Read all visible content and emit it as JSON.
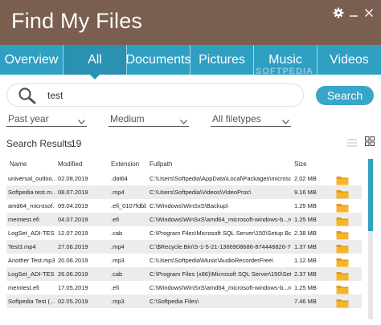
{
  "app": {
    "title": "Find My Files"
  },
  "tabs": [
    {
      "label": "Overview",
      "active": false
    },
    {
      "label": "All",
      "active": true
    },
    {
      "label": "Documents",
      "active": false
    },
    {
      "label": "Pictures",
      "active": false
    },
    {
      "label": "Music",
      "active": false
    },
    {
      "label": "Videos",
      "active": false
    }
  ],
  "watermark": "SOFTPEDIA",
  "search": {
    "value": "test",
    "button_label": "Search"
  },
  "filters": {
    "date": "Past year",
    "size": "Medium",
    "filetype": "All filetypes"
  },
  "results": {
    "label": "Search Results:",
    "count": "19"
  },
  "table": {
    "columns": {
      "name": "Name",
      "modified": "Modified",
      "extension": "Extension",
      "fullpath": "Fullpath",
      "size": "Size"
    },
    "rows": [
      {
        "name": "universal_outloo...",
        "modified": "02.08.2019",
        "ext": ".dat64",
        "path": "C:\\Users\\Softpedia\\AppData\\Local\\Packages\\microsoft.wi...",
        "size": "2.02 MB"
      },
      {
        "name": "Softpedia test.m...",
        "modified": "08.07.2019",
        "ext": ".mp4",
        "path": "C:\\Users\\Softpedia\\Videos\\VideoProc\\",
        "size": "9.16 MB"
      },
      {
        "name": "amd64_microsof...",
        "modified": "09.04.2019",
        "ext": ".efi_0107fdbb",
        "path": "C:\\Windows\\WinSxS\\Backup\\",
        "size": "1.25 MB"
      },
      {
        "name": "memtest.efi",
        "modified": "04.07.2019",
        "ext": ".efi",
        "path": "C:\\Windows\\WinSxS\\amd64_microsoft-windows-b...re-me...",
        "size": "1.25 MB"
      },
      {
        "name": "LogSet_ADI-TES...",
        "modified": "12.07.2019",
        "ext": ".cab",
        "path": "C:\\Program Files\\Microsoft SQL Server\\150\\Setup Bo...",
        "size": "2.38 MB"
      },
      {
        "name": "Test3.mp4",
        "modified": "27.06.2019",
        "ext": ".mp4",
        "path": "C:\\$Recycle.Bin\\S-1-5-21-1366908686-874448826-70079...",
        "size": "1.37 MB"
      },
      {
        "name": "Another Test.mp3",
        "modified": "20.06.2019",
        "ext": ".mp3",
        "path": "C:\\Users\\Softpedia\\Music\\AudioRecorderFree\\",
        "size": "1.12 MB"
      },
      {
        "name": "LogSet_ADI-TES...",
        "modified": "26.06.2019",
        "ext": ".cab",
        "path": "C:\\Program Files (x86)\\Microsoft SQL Server\\150\\Setup Bo...",
        "size": "2.37 MB"
      },
      {
        "name": "memtest.efi",
        "modified": "17.05.2019",
        "ext": ".efi",
        "path": "C:\\Windows\\WinSxS\\amd64_microsoft-windows-b...re-me...",
        "size": "1.25 MB"
      },
      {
        "name": "Softpedia Test (...",
        "modified": "02.05.2019",
        "ext": ".mp3",
        "path": "C:\\Softpedia Files\\",
        "size": "7.46 MB"
      }
    ]
  },
  "colors": {
    "titlebar": "#7a5f50",
    "tabbar": "#2f9fc2",
    "accent": "#39a6c9",
    "folder": "#f5b52b"
  }
}
